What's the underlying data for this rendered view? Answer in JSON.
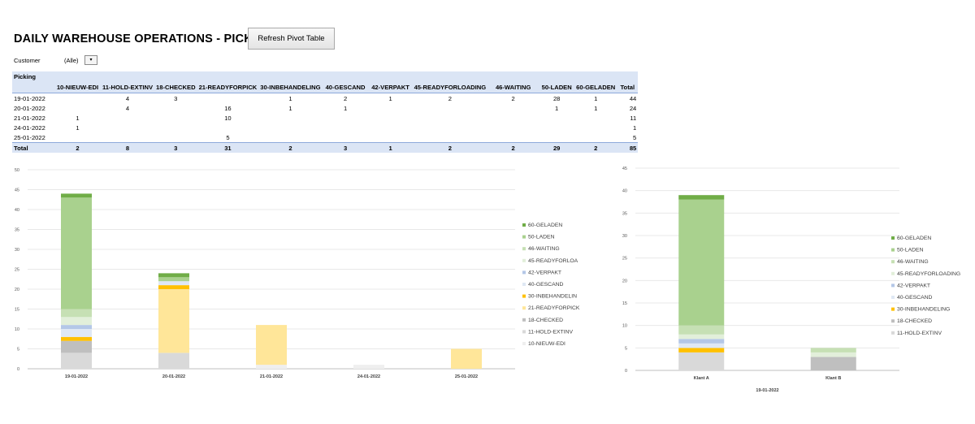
{
  "header": {
    "title": "DAILY WAREHOUSE OPERATIONS - PICKING",
    "refresh_label": "Refresh Pivot Table"
  },
  "filter": {
    "label": "Customer",
    "value": "(Alle)",
    "dropdown_icon": "chevron-down-icon"
  },
  "pivot": {
    "row_header": "Picking",
    "columns": [
      "10-NIEUW-EDI",
      "11-HOLD-EXTINV",
      "18-CHECKED",
      "21-READYFORPICK",
      "30-INBEHANDELING",
      "40-GESCAND",
      "42-VERPAKT",
      "45-READYFORLOADING",
      "46-WAITING",
      "50-LADEN",
      "60-GELADEN",
      "Total"
    ],
    "rows": [
      {
        "label": "19-01-2022",
        "cells": [
          "",
          "4",
          "3",
          "",
          "1",
          "2",
          "1",
          "2",
          "2",
          "28",
          "1",
          "44"
        ]
      },
      {
        "label": "20-01-2022",
        "cells": [
          "",
          "4",
          "",
          "16",
          "1",
          "1",
          "",
          "",
          "",
          "1",
          "1",
          "24"
        ]
      },
      {
        "label": "21-01-2022",
        "cells": [
          "1",
          "",
          "",
          "10",
          "",
          "",
          "",
          "",
          "",
          "",
          "",
          "11"
        ]
      },
      {
        "label": "24-01-2022",
        "cells": [
          "1",
          "",
          "",
          "",
          "",
          "",
          "",
          "",
          "",
          "",
          "",
          "1"
        ]
      },
      {
        "label": "25-01-2022",
        "cells": [
          "",
          "",
          "",
          "5",
          "",
          "",
          "",
          "",
          "",
          "",
          "",
          "5"
        ]
      }
    ],
    "total": {
      "label": "Total",
      "cells": [
        "2",
        "8",
        "3",
        "31",
        "2",
        "3",
        "1",
        "2",
        "2",
        "29",
        "2",
        "85"
      ]
    }
  },
  "chart_data": [
    {
      "type": "bar",
      "stacked": true,
      "categories": [
        "19-01-2022",
        "20-01-2022",
        "21-01-2022",
        "24-01-2022",
        "25-01-2022"
      ],
      "ylim": [
        0,
        50
      ],
      "yticks": [
        0,
        5,
        10,
        15,
        20,
        25,
        30,
        35,
        40,
        45,
        50
      ],
      "legend_position": "right",
      "series": [
        {
          "name": "10-NIEUW-EDI",
          "values": [
            0,
            0,
            1,
            1,
            0
          ]
        },
        {
          "name": "11-HOLD-EXTINV",
          "values": [
            4,
            4,
            0,
            0,
            0
          ]
        },
        {
          "name": "18-CHECKED",
          "values": [
            3,
            0,
            0,
            0,
            0
          ]
        },
        {
          "name": "21-READYFORPICK",
          "values": [
            0,
            16,
            10,
            0,
            5
          ]
        },
        {
          "name": "30-INBEHANDELING",
          "values": [
            1,
            1,
            0,
            0,
            0
          ]
        },
        {
          "name": "40-GESCAND",
          "values": [
            2,
            1,
            0,
            0,
            0
          ]
        },
        {
          "name": "42-VERPAKT",
          "values": [
            1,
            0,
            0,
            0,
            0
          ]
        },
        {
          "name": "45-READYFORLOADING",
          "values": [
            2,
            0,
            0,
            0,
            0
          ]
        },
        {
          "name": "46-WAITING",
          "values": [
            2,
            0,
            0,
            0,
            0
          ]
        },
        {
          "name": "50-LADEN",
          "values": [
            28,
            1,
            0,
            0,
            0
          ]
        },
        {
          "name": "60-GELADEN",
          "values": [
            1,
            1,
            0,
            0,
            0
          ]
        }
      ],
      "legend_labels": [
        "60-GELADEN",
        "50-LADEN",
        "46-WAITING",
        "45-READYFORLOA",
        "42-VERPAKT",
        "40-GESCAND",
        "30-INBEHANDELIN",
        "21-READYFORPICK",
        "18-CHECKED",
        "11-HOLD-EXTINV",
        "10-NIEUW-EDI"
      ]
    },
    {
      "type": "bar",
      "stacked": true,
      "categories": [
        "Klant A",
        "Klant B"
      ],
      "xlabel": "19-01-2022",
      "ylim": [
        0,
        45
      ],
      "yticks": [
        0,
        5,
        10,
        15,
        20,
        25,
        30,
        35,
        40,
        45
      ],
      "legend_position": "right",
      "series": [
        {
          "name": "11-HOLD-EXTINV",
          "values": [
            4,
            0
          ]
        },
        {
          "name": "18-CHECKED",
          "values": [
            0,
            3
          ]
        },
        {
          "name": "30-INBEHANDELING",
          "values": [
            1,
            0
          ]
        },
        {
          "name": "40-GESCAND",
          "values": [
            1,
            0
          ]
        },
        {
          "name": "42-VERPAKT",
          "values": [
            1,
            0
          ]
        },
        {
          "name": "45-READYFORLOADING",
          "values": [
            1,
            1
          ]
        },
        {
          "name": "46-WAITING",
          "values": [
            2,
            1
          ]
        },
        {
          "name": "50-LADEN",
          "values": [
            28,
            0
          ]
        },
        {
          "name": "60-GELADEN",
          "values": [
            1,
            0
          ]
        }
      ],
      "legend_labels": [
        "60-GELADEN",
        "50-LADEN",
        "46-WAITING",
        "45-READYFORLOADING",
        "42-VERPAKT",
        "40-GESCAND",
        "30-INBEHANDELING",
        "18-CHECKED",
        "11-HOLD-EXTINV"
      ]
    }
  ],
  "colors": {
    "10-NIEUW-EDI": "#efefef",
    "11-HOLD-EXTINV": "#d9d9d9",
    "18-CHECKED": "#bfbfbf",
    "21-READYFORPICK": "#ffe699",
    "30-INBEHANDELING": "#ffc000",
    "40-GESCAND": "#dfe8f4",
    "42-VERPAKT": "#b4c7e7",
    "45-READYFORLOADING": "#e2efda",
    "46-WAITING": "#c6e0b4",
    "50-LADEN": "#a9d18e",
    "60-GELADEN": "#70ad47"
  }
}
